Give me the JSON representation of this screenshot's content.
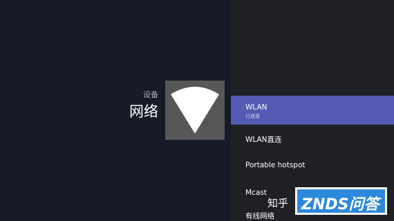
{
  "header": {
    "breadcrumb": "设备",
    "title": "网络"
  },
  "hero": {
    "icon": "wifi-icon"
  },
  "menu": {
    "items": [
      {
        "label": "WLAN",
        "sublabel": "已连接",
        "selected": true
      },
      {
        "label": "WLAN直连"
      },
      {
        "label": "Portable hotspot"
      },
      {
        "label": "Mcast"
      },
      {
        "label": "有线网络"
      }
    ]
  },
  "watermark": {
    "text": "知乎",
    "brand": "ZNDS问答"
  },
  "colors": {
    "accent": "#5459b2",
    "left_bg": "#161b27",
    "right_bg": "#1e2023",
    "tile_bg": "#575757",
    "watermark_blue": "#2c88db"
  }
}
